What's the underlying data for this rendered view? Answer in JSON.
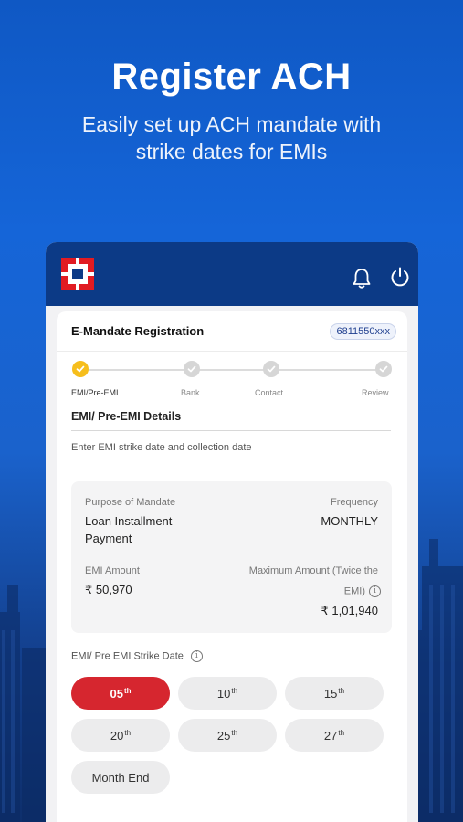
{
  "hero": {
    "title": "Register ACH",
    "subtitle_line1": "Easily set up ACH mandate with",
    "subtitle_line2": "strike dates for EMIs"
  },
  "appbar": {
    "icons": [
      "bank-logo",
      "bell-icon",
      "power-icon"
    ]
  },
  "card": {
    "title": "E-Mandate Registration",
    "loan_number": "6811550xxx"
  },
  "stepper": {
    "steps": [
      {
        "label": "EMI/Pre-EMI",
        "state": "active"
      },
      {
        "label": "Bank",
        "state": "pending"
      },
      {
        "label": "Contact",
        "state": "pending"
      },
      {
        "label": "Review",
        "state": "pending"
      }
    ]
  },
  "section": {
    "title": "EMI/ Pre-EMI Details",
    "subtitle": "Enter EMI strike date and collection date"
  },
  "details": {
    "purpose_label": "Purpose of Mandate",
    "purpose_value_line1": "Loan Installment",
    "purpose_value_line2": "Payment",
    "frequency_label": "Frequency",
    "frequency_value": "MONTHLY",
    "emi_amount_label": "EMI Amount",
    "emi_amount_value": "₹ 50,970",
    "max_amount_label_line1": "Maximum Amount (Twice the",
    "max_amount_label_line2": "EMI)",
    "max_amount_value": "₹ 1,01,940"
  },
  "strike": {
    "label": "EMI/ Pre EMI Strike Date",
    "selected": "05th",
    "options": [
      {
        "num": "05",
        "suffix": "th"
      },
      {
        "num": "10",
        "suffix": "th"
      },
      {
        "num": "15",
        "suffix": "th"
      },
      {
        "num": "20",
        "suffix": "th"
      },
      {
        "num": "25",
        "suffix": "th"
      },
      {
        "num": "27",
        "suffix": "th"
      },
      {
        "num": "Month End",
        "suffix": ""
      }
    ]
  },
  "colors": {
    "brand_blue": "#0c3a86",
    "accent_red": "#d6262f",
    "step_active": "#f6be1c"
  }
}
